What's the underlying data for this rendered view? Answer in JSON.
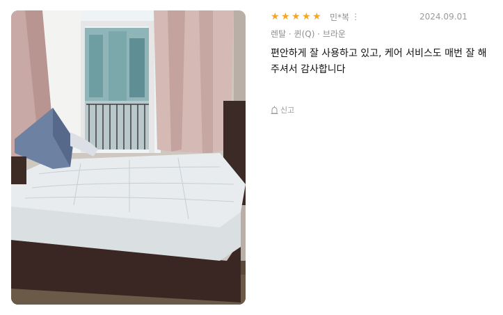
{
  "review": {
    "rating": 5,
    "stars": [
      "★",
      "★",
      "★",
      "★",
      "★"
    ],
    "author": "민*복",
    "more_icon": "⋮",
    "date": "2024.09.01",
    "option": "렌탈 · 퀸(Q) · 브라운",
    "content": "편안하게 잘 사용하고 있고, 케어 서비스도 매번 잘 해 주셔서 감사합니다",
    "report_label": "신고"
  },
  "colors": {
    "star": "#f5a623",
    "muted_text": "#8e8e8e",
    "body_text": "#111111"
  }
}
